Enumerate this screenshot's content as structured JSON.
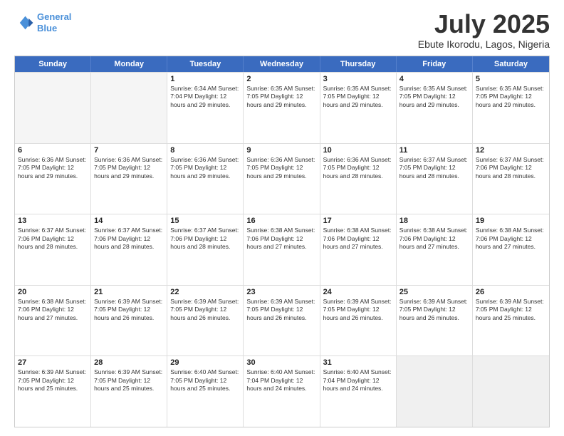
{
  "logo": {
    "line1": "General",
    "line2": "Blue"
  },
  "title": "July 2025",
  "location": "Ebute Ikorodu, Lagos, Nigeria",
  "header_days": [
    "Sunday",
    "Monday",
    "Tuesday",
    "Wednesday",
    "Thursday",
    "Friday",
    "Saturday"
  ],
  "weeks": [
    [
      {
        "day": "",
        "info": "",
        "empty": true
      },
      {
        "day": "",
        "info": "",
        "empty": true
      },
      {
        "day": "1",
        "info": "Sunrise: 6:34 AM\nSunset: 7:04 PM\nDaylight: 12 hours and 29 minutes."
      },
      {
        "day": "2",
        "info": "Sunrise: 6:35 AM\nSunset: 7:05 PM\nDaylight: 12 hours and 29 minutes."
      },
      {
        "day": "3",
        "info": "Sunrise: 6:35 AM\nSunset: 7:05 PM\nDaylight: 12 hours and 29 minutes."
      },
      {
        "day": "4",
        "info": "Sunrise: 6:35 AM\nSunset: 7:05 PM\nDaylight: 12 hours and 29 minutes."
      },
      {
        "day": "5",
        "info": "Sunrise: 6:35 AM\nSunset: 7:05 PM\nDaylight: 12 hours and 29 minutes."
      }
    ],
    [
      {
        "day": "6",
        "info": "Sunrise: 6:36 AM\nSunset: 7:05 PM\nDaylight: 12 hours and 29 minutes."
      },
      {
        "day": "7",
        "info": "Sunrise: 6:36 AM\nSunset: 7:05 PM\nDaylight: 12 hours and 29 minutes."
      },
      {
        "day": "8",
        "info": "Sunrise: 6:36 AM\nSunset: 7:05 PM\nDaylight: 12 hours and 29 minutes."
      },
      {
        "day": "9",
        "info": "Sunrise: 6:36 AM\nSunset: 7:05 PM\nDaylight: 12 hours and 29 minutes."
      },
      {
        "day": "10",
        "info": "Sunrise: 6:36 AM\nSunset: 7:05 PM\nDaylight: 12 hours and 28 minutes."
      },
      {
        "day": "11",
        "info": "Sunrise: 6:37 AM\nSunset: 7:05 PM\nDaylight: 12 hours and 28 minutes."
      },
      {
        "day": "12",
        "info": "Sunrise: 6:37 AM\nSunset: 7:06 PM\nDaylight: 12 hours and 28 minutes."
      }
    ],
    [
      {
        "day": "13",
        "info": "Sunrise: 6:37 AM\nSunset: 7:06 PM\nDaylight: 12 hours and 28 minutes."
      },
      {
        "day": "14",
        "info": "Sunrise: 6:37 AM\nSunset: 7:06 PM\nDaylight: 12 hours and 28 minutes."
      },
      {
        "day": "15",
        "info": "Sunrise: 6:37 AM\nSunset: 7:06 PM\nDaylight: 12 hours and 28 minutes."
      },
      {
        "day": "16",
        "info": "Sunrise: 6:38 AM\nSunset: 7:06 PM\nDaylight: 12 hours and 27 minutes."
      },
      {
        "day": "17",
        "info": "Sunrise: 6:38 AM\nSunset: 7:06 PM\nDaylight: 12 hours and 27 minutes."
      },
      {
        "day": "18",
        "info": "Sunrise: 6:38 AM\nSunset: 7:06 PM\nDaylight: 12 hours and 27 minutes."
      },
      {
        "day": "19",
        "info": "Sunrise: 6:38 AM\nSunset: 7:06 PM\nDaylight: 12 hours and 27 minutes."
      }
    ],
    [
      {
        "day": "20",
        "info": "Sunrise: 6:38 AM\nSunset: 7:06 PM\nDaylight: 12 hours and 27 minutes."
      },
      {
        "day": "21",
        "info": "Sunrise: 6:39 AM\nSunset: 7:05 PM\nDaylight: 12 hours and 26 minutes."
      },
      {
        "day": "22",
        "info": "Sunrise: 6:39 AM\nSunset: 7:05 PM\nDaylight: 12 hours and 26 minutes."
      },
      {
        "day": "23",
        "info": "Sunrise: 6:39 AM\nSunset: 7:05 PM\nDaylight: 12 hours and 26 minutes."
      },
      {
        "day": "24",
        "info": "Sunrise: 6:39 AM\nSunset: 7:05 PM\nDaylight: 12 hours and 26 minutes."
      },
      {
        "day": "25",
        "info": "Sunrise: 6:39 AM\nSunset: 7:05 PM\nDaylight: 12 hours and 26 minutes."
      },
      {
        "day": "26",
        "info": "Sunrise: 6:39 AM\nSunset: 7:05 PM\nDaylight: 12 hours and 25 minutes."
      }
    ],
    [
      {
        "day": "27",
        "info": "Sunrise: 6:39 AM\nSunset: 7:05 PM\nDaylight: 12 hours and 25 minutes."
      },
      {
        "day": "28",
        "info": "Sunrise: 6:39 AM\nSunset: 7:05 PM\nDaylight: 12 hours and 25 minutes."
      },
      {
        "day": "29",
        "info": "Sunrise: 6:40 AM\nSunset: 7:05 PM\nDaylight: 12 hours and 25 minutes."
      },
      {
        "day": "30",
        "info": "Sunrise: 6:40 AM\nSunset: 7:04 PM\nDaylight: 12 hours and 24 minutes."
      },
      {
        "day": "31",
        "info": "Sunrise: 6:40 AM\nSunset: 7:04 PM\nDaylight: 12 hours and 24 minutes."
      },
      {
        "day": "",
        "info": "",
        "empty": true,
        "shaded": true
      },
      {
        "day": "",
        "info": "",
        "empty": true,
        "shaded": true
      }
    ]
  ]
}
